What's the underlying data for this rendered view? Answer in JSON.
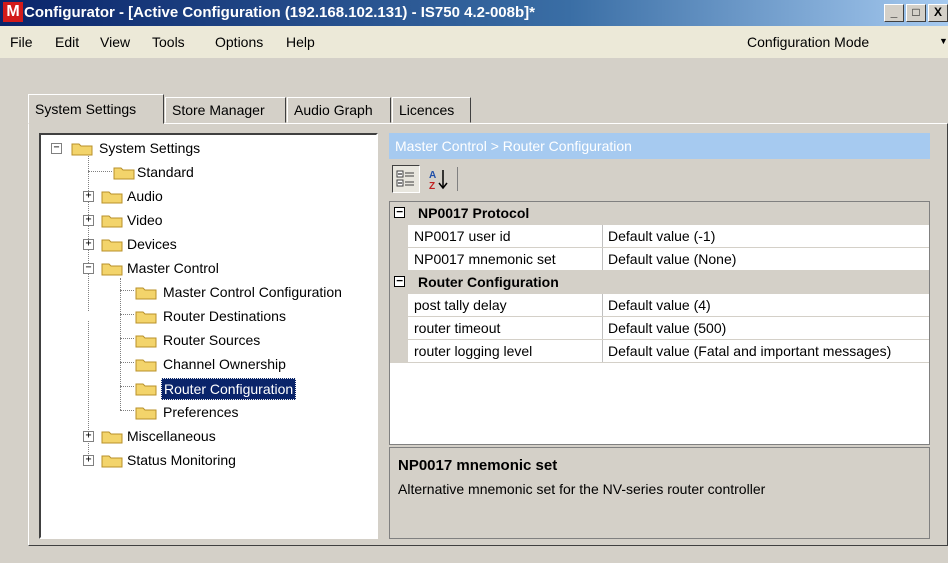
{
  "window": {
    "logo": "M",
    "title": "Configurator - [Active Configuration (192.168.102.131) - IS750 4.2-008b]*",
    "controls": [
      "_",
      "□",
      "X"
    ]
  },
  "menu": [
    "File",
    "Edit",
    "View",
    "Tools",
    "Options",
    "Help"
  ],
  "mode_select": "Configuration Mode",
  "tabs": [
    "System Settings",
    "Store Manager",
    "Audio Graph",
    "Licences"
  ],
  "active_tab": "System Settings",
  "tree": {
    "root": "System Settings",
    "items": [
      {
        "label": "Standard",
        "expander": ""
      },
      {
        "label": "Audio",
        "expander": "+"
      },
      {
        "label": "Video",
        "expander": "+"
      },
      {
        "label": "Devices",
        "expander": "+"
      },
      {
        "label": "Master Control",
        "expander": "-"
      },
      {
        "label": "Master Control Configuration"
      },
      {
        "label": "Router Destinations"
      },
      {
        "label": "Router Sources"
      },
      {
        "label": "Channel Ownership"
      },
      {
        "label": "Router Configuration",
        "selected": true
      },
      {
        "label": "Preferences"
      },
      {
        "label": "Miscellaneous",
        "expander": "+"
      },
      {
        "label": "Status Monitoring",
        "expander": "+"
      }
    ]
  },
  "breadcrumb": "Master Control > Router Configuration",
  "property_grid": {
    "categories": [
      {
        "name": "NP0017 Protocol",
        "expander": "⊟",
        "properties": [
          {
            "name": "NP0017 user id",
            "value": "Default value (-1)"
          },
          {
            "name": "NP0017 mnemonic set",
            "value": "Default value (None)"
          }
        ]
      },
      {
        "name": "Router Configuration",
        "expander": "⊟",
        "properties": [
          {
            "name": "post tally delay",
            "value": "Default value (4)"
          },
          {
            "name": "router timeout",
            "value": "Default value (500)"
          },
          {
            "name": "router logging level",
            "value": "Default value (Fatal and important messages)"
          }
        ]
      }
    ]
  },
  "help": {
    "title": "NP0017 mnemonic set",
    "description": "Alternative mnemonic set for the NV-series router controller"
  },
  "colors": {
    "title_bar": "#0a246a",
    "breadcrumb_bg": "#a6caf0",
    "selection": "#0a246a",
    "folder": "#f3d46b",
    "logo": "#d21a1a"
  },
  "icons": {
    "categorized_button": "categorized-icon",
    "alphabetical_button": "sort-alpha-icon",
    "tree_folder": "folder-icon"
  }
}
